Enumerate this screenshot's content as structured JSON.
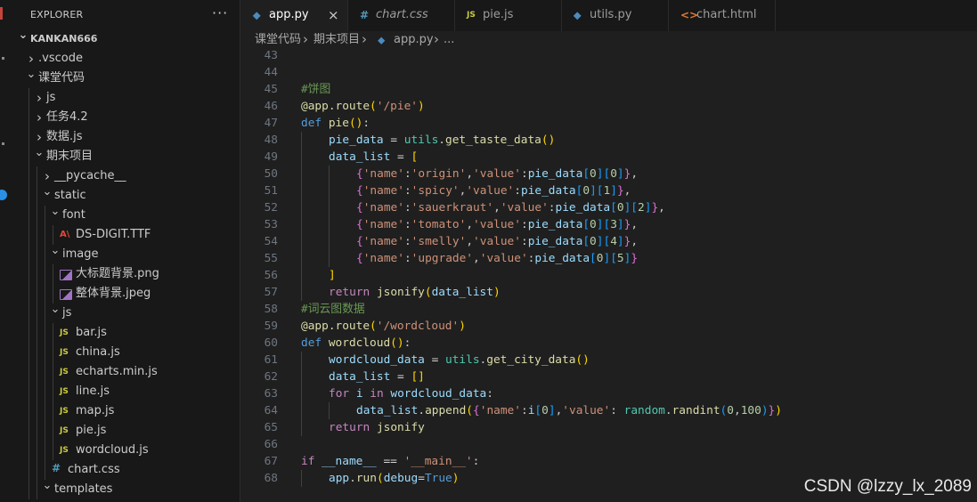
{
  "activity": {
    "colors": {
      "mark": "#c5443c",
      "badge": "#2a8fe6"
    }
  },
  "explorer": {
    "title": "EXPLORER",
    "more_label": "···",
    "items": [
      {
        "label": "KANKAN666",
        "depth": 0,
        "kind": "folder-open",
        "root": true
      },
      {
        "label": ".vscode",
        "depth": 1,
        "kind": "folder-closed"
      },
      {
        "label": "课堂代码",
        "depth": 1,
        "kind": "folder-open"
      },
      {
        "label": "js",
        "depth": 2,
        "kind": "folder-closed"
      },
      {
        "label": "任务4.2",
        "depth": 2,
        "kind": "folder-closed"
      },
      {
        "label": "数据.js",
        "depth": 2,
        "kind": "folder-closed"
      },
      {
        "label": "期末项目",
        "depth": 2,
        "kind": "folder-open"
      },
      {
        "label": "__pycache__",
        "depth": 3,
        "kind": "folder-closed"
      },
      {
        "label": "static",
        "depth": 3,
        "kind": "folder-open"
      },
      {
        "label": "font",
        "depth": 4,
        "kind": "folder-open"
      },
      {
        "label": "DS-DIGIT.TTF",
        "depth": 5,
        "kind": "file",
        "icon": "font-file-icon",
        "icon_text": "A\\"
      },
      {
        "label": "image",
        "depth": 4,
        "kind": "folder-open"
      },
      {
        "label": "大标题背景.png",
        "depth": 5,
        "kind": "file",
        "icon": "image-file-icon"
      },
      {
        "label": "整体背景.jpeg",
        "depth": 5,
        "kind": "file",
        "icon": "image-file-icon"
      },
      {
        "label": "js",
        "depth": 4,
        "kind": "folder-open"
      },
      {
        "label": "bar.js",
        "depth": 5,
        "kind": "file",
        "icon": "js-file-icon",
        "icon_text": "JS"
      },
      {
        "label": "china.js",
        "depth": 5,
        "kind": "file",
        "icon": "js-file-icon",
        "icon_text": "JS"
      },
      {
        "label": "echarts.min.js",
        "depth": 5,
        "kind": "file",
        "icon": "js-file-icon",
        "icon_text": "JS"
      },
      {
        "label": "line.js",
        "depth": 5,
        "kind": "file",
        "icon": "js-file-icon",
        "icon_text": "JS"
      },
      {
        "label": "map.js",
        "depth": 5,
        "kind": "file",
        "icon": "js-file-icon",
        "icon_text": "JS"
      },
      {
        "label": "pie.js",
        "depth": 5,
        "kind": "file",
        "icon": "js-file-icon",
        "icon_text": "JS"
      },
      {
        "label": "wordcloud.js",
        "depth": 5,
        "kind": "file",
        "icon": "js-file-icon",
        "icon_text": "JS"
      },
      {
        "label": "chart.css",
        "depth": 4,
        "kind": "file",
        "icon": "css-file-icon",
        "icon_text": "#"
      },
      {
        "label": "templates",
        "depth": 3,
        "kind": "folder-open"
      }
    ]
  },
  "tabs": [
    {
      "label": "app.py",
      "icon": "python-file-icon",
      "icon_text": "⬥",
      "active": true,
      "close": "×"
    },
    {
      "label": "chart.css",
      "icon": "css-file-icon",
      "icon_text": "#",
      "italic": true
    },
    {
      "label": "pie.js",
      "icon": "js-file-icon",
      "icon_text": "JS"
    },
    {
      "label": "utils.py",
      "icon": "python-file-icon",
      "icon_text": "⬥"
    },
    {
      "label": "chart.html",
      "icon": "html-file-icon",
      "icon_text": "<>"
    }
  ],
  "breadcrumb": {
    "parts": [
      "课堂代码",
      "›",
      "期末项目",
      "›",
      "⬥",
      "app.py",
      "›",
      "..."
    ]
  },
  "editor": {
    "lines": [
      {
        "n": "43",
        "indent": 0,
        "tokens": []
      },
      {
        "n": "44",
        "indent": 0,
        "tokens": []
      },
      {
        "n": "45",
        "indent": 0,
        "tokens": [
          [
            "comment",
            "#饼图"
          ]
        ]
      },
      {
        "n": "46",
        "indent": 0,
        "tokens": [
          [
            "decorator",
            "@app.route"
          ],
          [
            "b1",
            "("
          ],
          [
            "string",
            "'/pie'"
          ],
          [
            "b1",
            ")"
          ]
        ]
      },
      {
        "n": "47",
        "indent": 0,
        "tokens": [
          [
            "keyword",
            "def "
          ],
          [
            "func",
            "pie"
          ],
          [
            "b1",
            "()"
          ],
          [
            "punct",
            ":"
          ]
        ]
      },
      {
        "n": "48",
        "indent": 1,
        "tokens": [
          [
            "var",
            "pie_data"
          ],
          [
            "op",
            " = "
          ],
          [
            "module",
            "utils"
          ],
          [
            "punct",
            "."
          ],
          [
            "func",
            "get_taste_data"
          ],
          [
            "b1",
            "()"
          ]
        ]
      },
      {
        "n": "49",
        "indent": 1,
        "tokens": [
          [
            "var",
            "data_list"
          ],
          [
            "op",
            " = "
          ],
          [
            "b1",
            "["
          ]
        ]
      },
      {
        "n": "50",
        "indent": 2,
        "tokens": [
          [
            "b2",
            "{"
          ],
          [
            "string",
            "'name'"
          ],
          [
            "punct",
            ":"
          ],
          [
            "string",
            "'origin'"
          ],
          [
            "punct",
            ","
          ],
          [
            "string",
            "'value'"
          ],
          [
            "punct",
            ":"
          ],
          [
            "var",
            "pie_data"
          ],
          [
            "b3",
            "["
          ],
          [
            "number",
            "0"
          ],
          [
            "b3",
            "]"
          ],
          [
            "b3",
            "["
          ],
          [
            "number",
            "0"
          ],
          [
            "b3",
            "]"
          ],
          [
            "b2",
            "}"
          ],
          [
            "punct",
            ","
          ]
        ]
      },
      {
        "n": "51",
        "indent": 2,
        "tokens": [
          [
            "b2",
            "{"
          ],
          [
            "string",
            "'name'"
          ],
          [
            "punct",
            ":"
          ],
          [
            "string",
            "'spicy'"
          ],
          [
            "punct",
            ","
          ],
          [
            "string",
            "'value'"
          ],
          [
            "punct",
            ":"
          ],
          [
            "var",
            "pie_data"
          ],
          [
            "b3",
            "["
          ],
          [
            "number",
            "0"
          ],
          [
            "b3",
            "]"
          ],
          [
            "b3",
            "["
          ],
          [
            "number",
            "1"
          ],
          [
            "b3",
            "]"
          ],
          [
            "b2",
            "}"
          ],
          [
            "punct",
            ","
          ]
        ]
      },
      {
        "n": "52",
        "indent": 2,
        "tokens": [
          [
            "b2",
            "{"
          ],
          [
            "string",
            "'name'"
          ],
          [
            "punct",
            ":"
          ],
          [
            "string",
            "'sauerkraut'"
          ],
          [
            "punct",
            ","
          ],
          [
            "string",
            "'value'"
          ],
          [
            "punct",
            ":"
          ],
          [
            "var",
            "pie_data"
          ],
          [
            "b3",
            "["
          ],
          [
            "number",
            "0"
          ],
          [
            "b3",
            "]"
          ],
          [
            "b3",
            "["
          ],
          [
            "number",
            "2"
          ],
          [
            "b3",
            "]"
          ],
          [
            "b2",
            "}"
          ],
          [
            "punct",
            ","
          ]
        ]
      },
      {
        "n": "53",
        "indent": 2,
        "tokens": [
          [
            "b2",
            "{"
          ],
          [
            "string",
            "'name'"
          ],
          [
            "punct",
            ":"
          ],
          [
            "string",
            "'tomato'"
          ],
          [
            "punct",
            ","
          ],
          [
            "string",
            "'value'"
          ],
          [
            "punct",
            ":"
          ],
          [
            "var",
            "pie_data"
          ],
          [
            "b3",
            "["
          ],
          [
            "number",
            "0"
          ],
          [
            "b3",
            "]"
          ],
          [
            "b3",
            "["
          ],
          [
            "number",
            "3"
          ],
          [
            "b3",
            "]"
          ],
          [
            "b2",
            "}"
          ],
          [
            "punct",
            ","
          ]
        ]
      },
      {
        "n": "54",
        "indent": 2,
        "tokens": [
          [
            "b2",
            "{"
          ],
          [
            "string",
            "'name'"
          ],
          [
            "punct",
            ":"
          ],
          [
            "string",
            "'smelly'"
          ],
          [
            "punct",
            ","
          ],
          [
            "string",
            "'value'"
          ],
          [
            "punct",
            ":"
          ],
          [
            "var",
            "pie_data"
          ],
          [
            "b3",
            "["
          ],
          [
            "number",
            "0"
          ],
          [
            "b3",
            "]"
          ],
          [
            "b3",
            "["
          ],
          [
            "number",
            "4"
          ],
          [
            "b3",
            "]"
          ],
          [
            "b2",
            "}"
          ],
          [
            "punct",
            ","
          ]
        ]
      },
      {
        "n": "55",
        "indent": 2,
        "tokens": [
          [
            "b2",
            "{"
          ],
          [
            "string",
            "'name'"
          ],
          [
            "punct",
            ":"
          ],
          [
            "string",
            "'upgrade'"
          ],
          [
            "punct",
            ","
          ],
          [
            "string",
            "'value'"
          ],
          [
            "punct",
            ":"
          ],
          [
            "var",
            "pie_data"
          ],
          [
            "b3",
            "["
          ],
          [
            "number",
            "0"
          ],
          [
            "b3",
            "]"
          ],
          [
            "b3",
            "["
          ],
          [
            "number",
            "5"
          ],
          [
            "b3",
            "]"
          ],
          [
            "b2",
            "}"
          ]
        ]
      },
      {
        "n": "56",
        "indent": 1,
        "tokens": [
          [
            "b1",
            "]"
          ]
        ]
      },
      {
        "n": "57",
        "indent": 1,
        "tokens": [
          [
            "control",
            "return "
          ],
          [
            "func",
            "jsonify"
          ],
          [
            "b1",
            "("
          ],
          [
            "var",
            "data_list"
          ],
          [
            "b1",
            ")"
          ]
        ]
      },
      {
        "n": "58",
        "indent": 0,
        "tokens": [
          [
            "comment",
            "#词云图数据"
          ]
        ]
      },
      {
        "n": "59",
        "indent": 0,
        "tokens": [
          [
            "decorator",
            "@app.route"
          ],
          [
            "b1",
            "("
          ],
          [
            "string",
            "'/wordcloud'"
          ],
          [
            "b1",
            ")"
          ]
        ]
      },
      {
        "n": "60",
        "indent": 0,
        "tokens": [
          [
            "keyword",
            "def "
          ],
          [
            "func",
            "wordcloud"
          ],
          [
            "b1",
            "()"
          ],
          [
            "punct",
            ":"
          ]
        ]
      },
      {
        "n": "61",
        "indent": 1,
        "tokens": [
          [
            "var",
            "wordcloud_data"
          ],
          [
            "op",
            " = "
          ],
          [
            "module",
            "utils"
          ],
          [
            "punct",
            "."
          ],
          [
            "func",
            "get_city_data"
          ],
          [
            "b1",
            "()"
          ]
        ]
      },
      {
        "n": "62",
        "indent": 1,
        "tokens": [
          [
            "var",
            "data_list"
          ],
          [
            "op",
            " = "
          ],
          [
            "b1",
            "[]"
          ]
        ]
      },
      {
        "n": "63",
        "indent": 1,
        "tokens": [
          [
            "control",
            "for "
          ],
          [
            "var",
            "i"
          ],
          [
            "control",
            " in "
          ],
          [
            "var",
            "wordcloud_data"
          ],
          [
            "punct",
            ":"
          ]
        ]
      },
      {
        "n": "64",
        "indent": 2,
        "tokens": [
          [
            "var",
            "data_list"
          ],
          [
            "punct",
            "."
          ],
          [
            "func",
            "append"
          ],
          [
            "b1",
            "("
          ],
          [
            "b2",
            "{"
          ],
          [
            "string",
            "'name'"
          ],
          [
            "punct",
            ":"
          ],
          [
            "var",
            "i"
          ],
          [
            "b3",
            "["
          ],
          [
            "number",
            "0"
          ],
          [
            "b3",
            "]"
          ],
          [
            "punct",
            ","
          ],
          [
            "string",
            "'value'"
          ],
          [
            "punct",
            ": "
          ],
          [
            "module",
            "random"
          ],
          [
            "punct",
            "."
          ],
          [
            "func",
            "randint"
          ],
          [
            "b3",
            "("
          ],
          [
            "number",
            "0"
          ],
          [
            "punct",
            ","
          ],
          [
            "number",
            "100"
          ],
          [
            "b3",
            ")"
          ],
          [
            "b2",
            "}"
          ],
          [
            "b1",
            ")"
          ]
        ]
      },
      {
        "n": "65",
        "indent": 1,
        "tokens": [
          [
            "control",
            "return "
          ],
          [
            "func",
            "jsonify"
          ]
        ]
      },
      {
        "n": "66",
        "indent": 0,
        "tokens": []
      },
      {
        "n": "67",
        "indent": 0,
        "tokens": [
          [
            "control",
            "if "
          ],
          [
            "dunder",
            "__name__"
          ],
          [
            "op",
            " == "
          ],
          [
            "string",
            "'__main__'"
          ],
          [
            "punct",
            ":"
          ]
        ]
      },
      {
        "n": "68",
        "indent": 1,
        "tokens": [
          [
            "var",
            "app"
          ],
          [
            "punct",
            "."
          ],
          [
            "func",
            "run"
          ],
          [
            "b1",
            "("
          ],
          [
            "var",
            "debug"
          ],
          [
            "op",
            "="
          ],
          [
            "const",
            "True"
          ],
          [
            "b1",
            ")"
          ]
        ]
      }
    ]
  },
  "watermark": {
    "text": "CSDN @lzzy_lx_2089"
  },
  "theme": {
    "editor_bg": "#1f1f1f",
    "sidebar_bg": "#181818",
    "comment": "#6a9955",
    "keyword": "#569cd6",
    "string": "#ce9178",
    "function": "#dcdcaa",
    "variable": "#9cdcfe"
  }
}
